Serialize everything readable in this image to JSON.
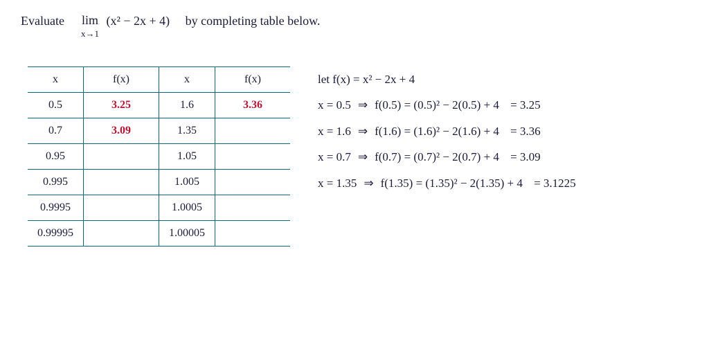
{
  "title": {
    "evaluate": "Evaluate",
    "lim": "lim",
    "limsub": "x→1",
    "expr": "(x² − 2x + 4)",
    "rest": "by completing table below."
  },
  "table": {
    "headers": [
      "x",
      "f(x)",
      "x",
      "f(x)"
    ],
    "rows": [
      {
        "x1": "0.5",
        "f1": "3.25",
        "x2": "1.6",
        "f2": "3.36"
      },
      {
        "x1": "0.7",
        "f1": "3.09",
        "x2": "1.35",
        "f2": ""
      },
      {
        "x1": "0.95",
        "f1": "",
        "x2": "1.05",
        "f2": ""
      },
      {
        "x1": "0.995",
        "f1": "",
        "x2": "1.005",
        "f2": ""
      },
      {
        "x1": "0.9995",
        "f1": "",
        "x2": "1.0005",
        "f2": ""
      },
      {
        "x1": "0.99995",
        "f1": "",
        "x2": "1.00005",
        "f2": ""
      }
    ]
  },
  "work": {
    "let": "let f(x) = x² − 2x + 4",
    "lines": [
      {
        "x": "x = 0.5",
        "arrow": "⇒",
        "fpart": "f(0.5) = (0.5)² − 2(0.5) + 4",
        "eq": "= 3.25"
      },
      {
        "x": "x = 1.6",
        "arrow": "⇒",
        "fpart": "f(1.6) = (1.6)² − 2(1.6) + 4",
        "eq": "= 3.36"
      },
      {
        "x": "x = 0.7",
        "arrow": "⇒",
        "fpart": "f(0.7) = (0.7)² − 2(0.7) + 4",
        "eq": "= 3.09"
      },
      {
        "x": "x = 1.35",
        "arrow": "⇒",
        "fpart": "f(1.35) = (1.35)² − 2(1.35) + 4",
        "eq": "= 3.1225"
      }
    ]
  }
}
